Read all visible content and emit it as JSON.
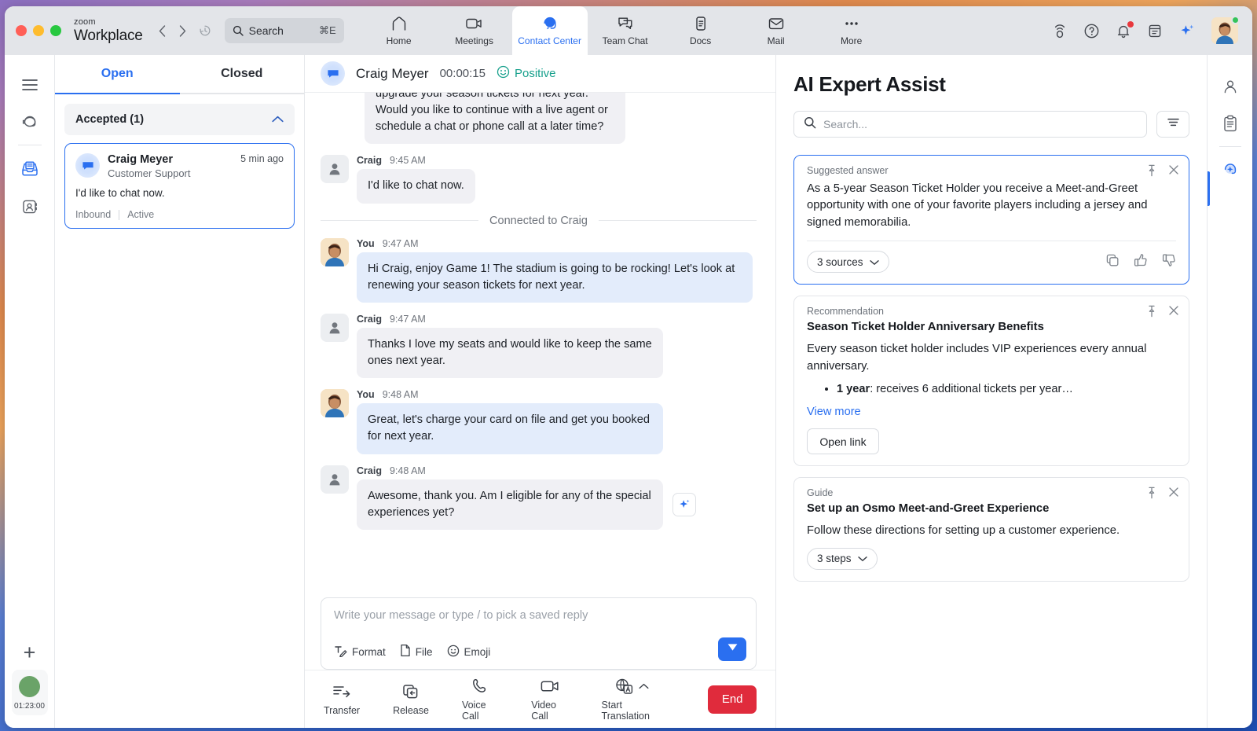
{
  "titlebar": {
    "brand_top": "zoom",
    "brand_bottom": "Workplace",
    "search_label": "Search",
    "search_shortcut": "⌘E",
    "tabs": [
      {
        "label": "Home",
        "icon": "home-icon"
      },
      {
        "label": "Meetings",
        "icon": "video-camera-icon"
      },
      {
        "label": "Contact Center",
        "icon": "headset-chat-icon"
      },
      {
        "label": "Team Chat",
        "icon": "chat-bubbles-icon"
      },
      {
        "label": "Docs",
        "icon": "document-icon"
      },
      {
        "label": "Mail",
        "icon": "envelope-icon"
      },
      {
        "label": "More",
        "icon": "ellipsis-icon"
      }
    ],
    "active_tab": "Contact Center",
    "system_icons": [
      "cast-icon",
      "help-icon",
      "notification-bell-icon",
      "calendar-icon",
      "ai-sparkle-icon",
      "avatar"
    ]
  },
  "left_rail": {
    "items": [
      "hamburger-menu-icon",
      "headset-icon",
      "inbox-icon",
      "contacts-icon"
    ],
    "selected": "inbox-icon",
    "add_label": "+",
    "status_timer": "01:23:00"
  },
  "engagement_list": {
    "tabs": [
      {
        "label": "Open",
        "active": true
      },
      {
        "label": "Closed",
        "active": false
      }
    ],
    "group": {
      "label": "Accepted (1)",
      "expanded": true
    },
    "items": [
      {
        "name": "Craig Meyer",
        "queue": "Customer Support",
        "time": "5 min ago",
        "preview": "I'd like to chat now.",
        "direction": "Inbound",
        "status": "Active"
      }
    ]
  },
  "conversation": {
    "header": {
      "name": "Craig Meyer",
      "timer": "00:00:15",
      "sentiment": "Positive"
    },
    "messages": [
      {
        "id": "m0",
        "side": "them",
        "clipped": true,
        "text": "upgrade your season tickets for next year. Would you like to continue with a live agent or schedule a chat or phone call at a later time?"
      },
      {
        "id": "m1",
        "side": "them",
        "who": "Craig",
        "time": "9:45 AM",
        "text": "I'd like to chat now."
      },
      {
        "id": "divider",
        "label": "Connected to Craig"
      },
      {
        "id": "m2",
        "side": "me",
        "who": "You",
        "time": "9:47 AM",
        "text": "Hi Craig, enjoy Game 1! The stadium is going to be rocking! Let's look at renewing your season tickets for next year."
      },
      {
        "id": "m3",
        "side": "them",
        "who": "Craig",
        "time": "9:47 AM",
        "text": "Thanks I love my seats and would like to keep the same ones next year."
      },
      {
        "id": "m4",
        "side": "me",
        "who": "You",
        "time": "9:48 AM",
        "text": "Great, let's charge your card on file and get you booked for next year."
      },
      {
        "id": "m5",
        "side": "them",
        "who": "Craig",
        "time": "9:48 AM",
        "text": "Awesome, thank you. Am I eligible for any of the special experiences yet?",
        "has_sparkle": true
      }
    ],
    "composer": {
      "placeholder": "Write your message or type / to pick a saved reply",
      "tools": [
        {
          "label": "Format",
          "icon": "format-text-icon"
        },
        {
          "label": "File",
          "icon": "file-icon"
        },
        {
          "label": "Emoji",
          "icon": "emoji-icon"
        }
      ],
      "send_icon": "send-icon"
    },
    "callbar": {
      "buttons": [
        {
          "label": "Transfer",
          "icon": "transfer-icon"
        },
        {
          "label": "Release",
          "icon": "release-icon"
        },
        {
          "label": "Voice Call",
          "icon": "phone-icon"
        },
        {
          "label": "Video Call",
          "icon": "video-icon"
        },
        {
          "label": "Start Translation",
          "icon": "translate-icon"
        }
      ],
      "end_label": "End"
    }
  },
  "ai_panel": {
    "title": "AI Expert Assist",
    "search_placeholder": "Search...",
    "filter_icon": "filter-icon",
    "cards": [
      {
        "kicker": "Suggested answer",
        "highlighted": true,
        "body": "As a 5-year Season Ticket Holder you receive a Meet-and-Greet opportunity with one of your favorite players including a jersey and signed memorabilia.",
        "pill": "3 sources",
        "foot_icons": [
          "copy-icon",
          "thumbs-up-icon",
          "thumbs-down-icon"
        ]
      },
      {
        "kicker": "Recommendation",
        "heading": "Season Ticket Holder Anniversary Benefits",
        "body": "Every season ticket holder includes VIP experiences every annual anniversary.",
        "bullet_bold": "1 year",
        "bullet_rest": ": receives 6 additional tickets per year…",
        "view_more": "View more",
        "button": "Open link"
      },
      {
        "kicker": "Guide",
        "heading": "Set up an Osmo Meet-and-Greet Experience",
        "body": "Follow these directions for setting up a customer experience.",
        "pill": "3 steps"
      }
    ]
  },
  "right_rail": {
    "items": [
      "person-icon",
      "clipboard-icon",
      "ai-assist-icon"
    ],
    "selected": "ai-assist-icon"
  },
  "colors": {
    "accent": "#2a6ff0",
    "end_red": "#e02b3c",
    "sentiment_teal": "#17a08c",
    "status_green": "#6aa368"
  }
}
